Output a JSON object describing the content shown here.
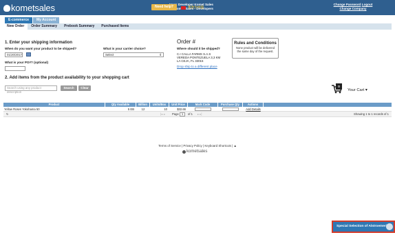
{
  "header": {
    "brand": "kometsales",
    "user_line": "User: Developer Komet Sales",
    "company_line": "Company: Komet Sales - Developers",
    "help_label": "Need help?",
    "language_label": "更改为中国",
    "change_password": "Change Password",
    "logout": "Logout",
    "change_company": "Change Company"
  },
  "main_tabs": [
    {
      "label": "E-commerce",
      "active": true
    },
    {
      "label": "My Account",
      "active": false
    }
  ],
  "sub_tabs": [
    {
      "label": "New Order",
      "active": true
    },
    {
      "label": "Order Summary",
      "active": false
    },
    {
      "label": "Prebook Summary",
      "active": false
    },
    {
      "label": "Purchased Items",
      "active": false
    }
  ],
  "shipping": {
    "title": "1. Enter your shipping information",
    "date_label": "When do you want your product to be shipped?",
    "date_value": "01/20/2017",
    "po_label": "What is your PO#? (optional)",
    "carrier_label": "What is your carrier choice?",
    "carrier_value": "Select"
  },
  "order": {
    "title": "Order #",
    "ship_to_label": "Where should it be shipped?",
    "ship_to_lines": [
      "C.I CALLA FARMS S.A.S",
      "VEREDA PONTEZUELA 3,3 KM",
      "LA CEJA, FL 33015"
    ],
    "drop_ship_link": "Drop ship to a different place"
  },
  "rules": {
    "title": "Rules and Conditions",
    "text": "None product will be delivered the same day of the request."
  },
  "products": {
    "title": "2. Add items from the product availability to your shopping cart",
    "search_placeholder": "Search using any product description",
    "search_button": "Search",
    "clear_button": "Clear"
  },
  "cart": {
    "count": "0",
    "label": "Your Cart ▾"
  },
  "table": {
    "columns": [
      "Product",
      "Qty Available",
      "Billion",
      "Units/Box",
      "Unit Price",
      "Mark Code",
      "Purchase Qty",
      "Actions"
    ],
    "rows": [
      {
        "product": "Yellow Roses Yokohama 50",
        "qty": "5 EB",
        "billion": "12",
        "units": "10",
        "price": "$32.66",
        "action": "Add Details"
      }
    ],
    "pager": {
      "page_label": "Page",
      "page_value": "1",
      "of_label": "of 1",
      "records": "Showing 1 to 1 records of 1"
    }
  },
  "footer": {
    "terms": "Terms of Service",
    "privacy": "Privacy Policy",
    "shortcuts": "Keyboard Shortcuts",
    "brand": "kometsales"
  },
  "special_button": "Special Selection of Alstroemeria"
}
